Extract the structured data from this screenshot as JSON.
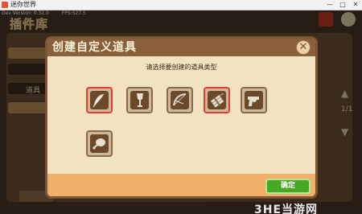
{
  "window": {
    "title": "迷你世界",
    "minimize": "—",
    "maximize": "□",
    "close": "✕"
  },
  "dev": {
    "version": "Dev Version: 0.32.0",
    "fps": "FPS:527.5"
  },
  "background": {
    "title": "插件库",
    "side_label": "道具",
    "page": "1/1"
  },
  "dialog": {
    "title": "创建自定义道具",
    "prompt": "请选择要创建的道具类型",
    "confirm_label": "确定",
    "close_icon": "close-icon",
    "item_types": [
      {
        "icon": "quill-feather-icon",
        "selected": true
      },
      {
        "icon": "shovel-icon",
        "selected": false
      },
      {
        "icon": "bow-icon",
        "selected": false
      },
      {
        "icon": "dynamite-bundle-icon",
        "selected": true
      },
      {
        "icon": "revolver-icon",
        "selected": false
      },
      {
        "icon": "meat-drumstick-icon",
        "selected": false
      }
    ]
  },
  "watermark": "3HE当游网",
  "colors": {
    "header": "#8a5f3c",
    "panel": "#f3e2bf",
    "footer": "#f0b06a",
    "confirm": "#46a824",
    "selection": "#e43a3a"
  }
}
